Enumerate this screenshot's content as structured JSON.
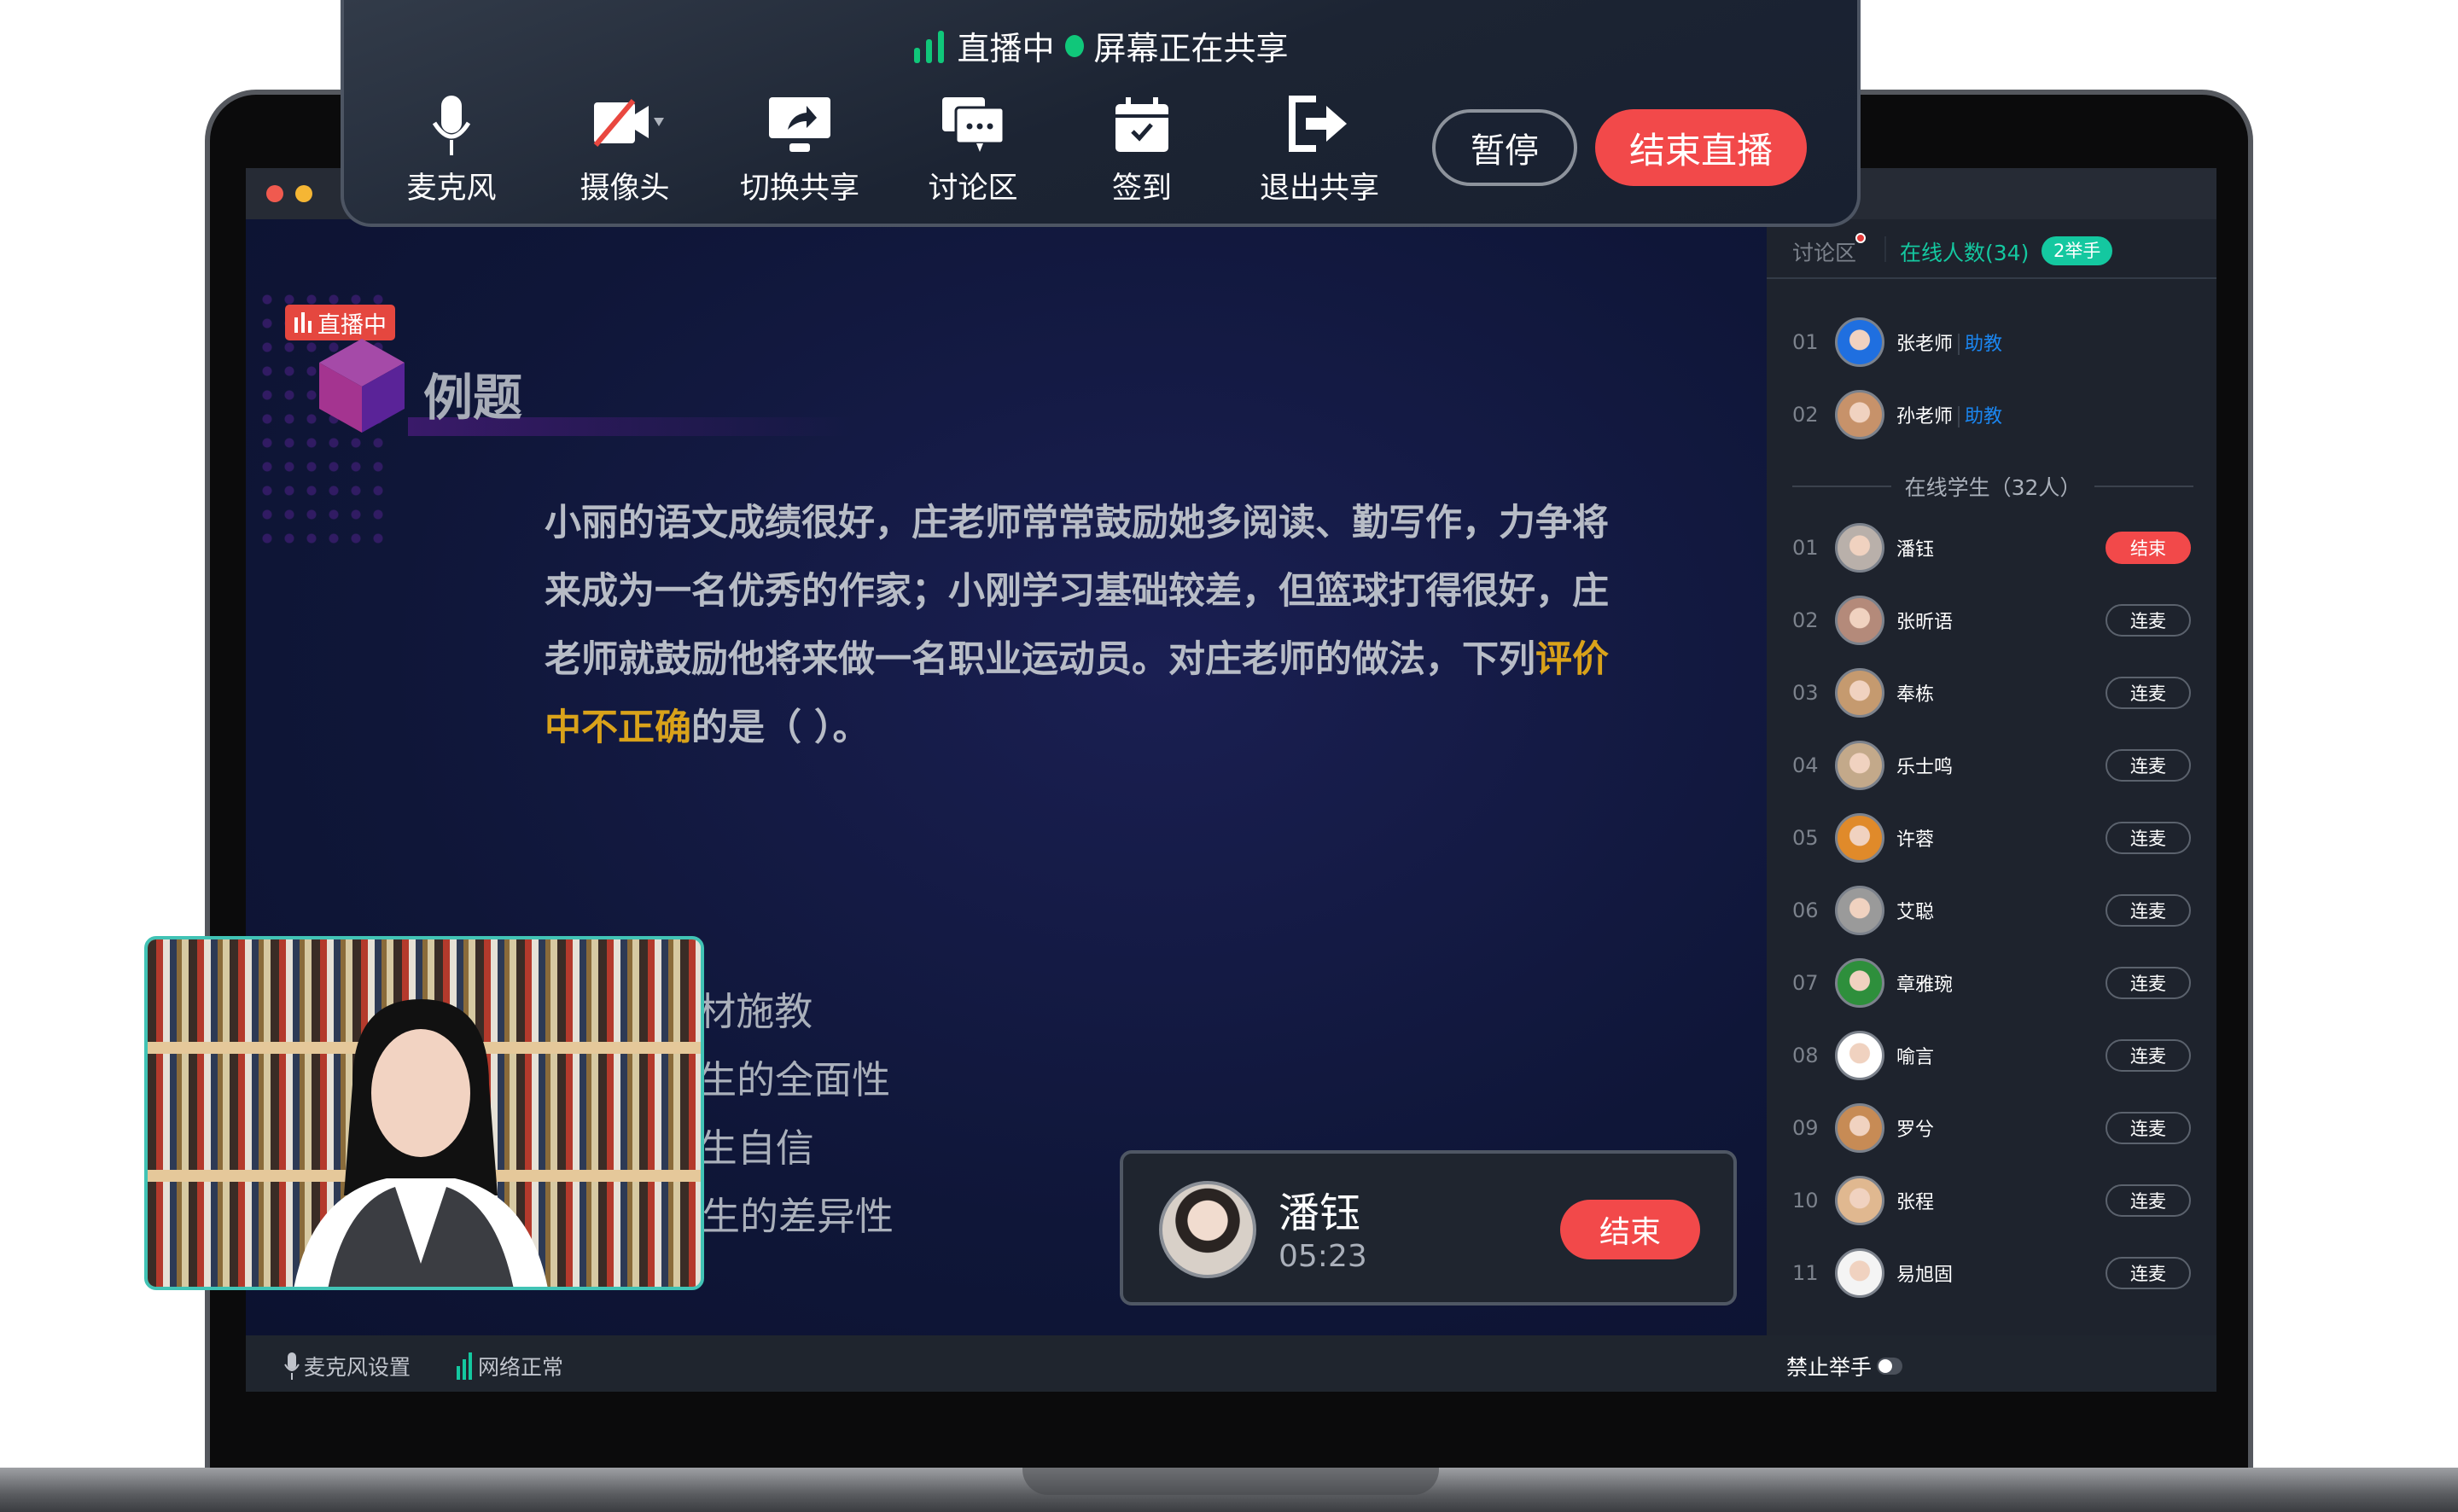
{
  "toolbar": {
    "status_live": "直播中",
    "status_share": "屏幕正在共享",
    "buttons": [
      {
        "label": "麦克风",
        "icon": "microphone-icon"
      },
      {
        "label": "摄像头",
        "icon": "camera-off-icon"
      },
      {
        "label": "切换共享",
        "icon": "switch-share-icon"
      },
      {
        "label": "讨论区",
        "icon": "chat-icon"
      },
      {
        "label": "签到",
        "icon": "calendar-check-icon"
      },
      {
        "label": "退出共享",
        "icon": "exit-share-icon"
      }
    ],
    "pause": "暂停",
    "end_live": "结束直播",
    "accent_green": "#10c77a",
    "accent_red": "#f2494a"
  },
  "slide": {
    "live_tag": "直播中",
    "title": "例题",
    "question_parts": [
      "小丽的语文成绩很好，庄老师常常鼓励她多阅读、勤写作，力争将来成为一名优秀的作家；小刚学习基础较差，但篮球打得很好，庄老师就鼓励他将来做一名职业运动员。对庄老师的做法，下列",
      "评价中不正确",
      "的是（ ）。"
    ],
    "options": [
      "A.善于因材施教",
      "B.注重学生的全面性",
      "C.激发学生自信",
      "D.尊重学生的差异性"
    ]
  },
  "call": {
    "name": "潘钰",
    "time": "05:23",
    "end": "结束"
  },
  "sidebar": {
    "tab_chat": "讨论区",
    "tab_online": "在线人数(34)",
    "raise_badge": "2举手",
    "online_color": "#14c8a0",
    "teachers": [
      {
        "num": "01",
        "name": "张老师",
        "role": "助教"
      },
      {
        "num": "02",
        "name": "孙老师",
        "role": "助教"
      }
    ],
    "students_header": "在线学生（32人）",
    "students": [
      {
        "num": "01",
        "name": "潘钰",
        "action": "结束"
      },
      {
        "num": "02",
        "name": "张昕语",
        "action": "连麦"
      },
      {
        "num": "03",
        "name": "奉栋",
        "action": "连麦"
      },
      {
        "num": "04",
        "name": "乐士鸣",
        "action": "连麦"
      },
      {
        "num": "05",
        "name": "许蓉",
        "action": "连麦"
      },
      {
        "num": "06",
        "name": "艾聪",
        "action": "连麦"
      },
      {
        "num": "07",
        "name": "章雅琬",
        "action": "连麦"
      },
      {
        "num": "08",
        "name": "喻言",
        "action": "连麦"
      },
      {
        "num": "09",
        "name": "罗兮",
        "action": "连麦"
      },
      {
        "num": "10",
        "name": "张程",
        "action": "连麦"
      },
      {
        "num": "11",
        "name": "易旭固",
        "action": "连麦"
      }
    ]
  },
  "statusbar": {
    "mic_settings": "麦克风设置",
    "network": "网络正常",
    "ban_raise": "禁止举手",
    "ban_raise_on": false
  }
}
